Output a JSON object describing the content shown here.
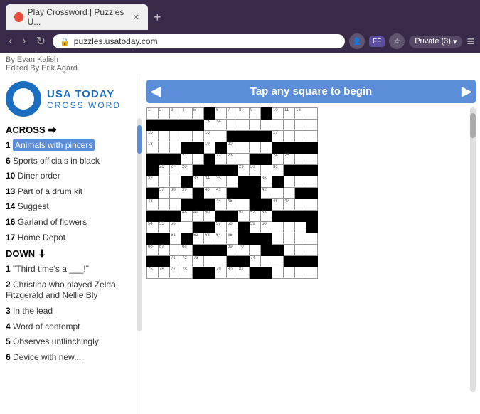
{
  "browser": {
    "tab_title": "Play Crossword | Puzzles U...",
    "url": "puzzles.usatoday.com",
    "private_label": "Private (3)",
    "new_tab_icon": "+",
    "menu_icon": "≡"
  },
  "page": {
    "author": "By Evan Kalish",
    "editor": "Edited By Erik Agard"
  },
  "logo": {
    "usa": "USA TODAY",
    "crossword": "CROSS WORD"
  },
  "clues": {
    "across_label": "ACROSS",
    "down_label": "DOWN",
    "across_items": [
      {
        "number": "1",
        "text": "Animals with pincers"
      },
      {
        "number": "6",
        "text": "Sports officials in black"
      },
      {
        "number": "10",
        "text": "Diner order"
      },
      {
        "number": "13",
        "text": "Part of a drum kit"
      },
      {
        "number": "14",
        "text": "Suggest"
      },
      {
        "number": "16",
        "text": "Garland of flowers"
      },
      {
        "number": "17",
        "text": "Home Depot"
      }
    ],
    "down_items": [
      {
        "number": "1",
        "text": "\"Third time's a ___!\""
      },
      {
        "number": "2",
        "text": "Christina who played Zelda Fitzgerald and Nellie Bly"
      },
      {
        "number": "3",
        "text": "In the lead"
      },
      {
        "number": "4",
        "text": "Word of contempt"
      },
      {
        "number": "5",
        "text": "Observes unflinchingly"
      },
      {
        "number": "6",
        "text": "Device with new..."
      }
    ]
  },
  "grid_header": {
    "title": "Tap any square to begin",
    "left_arrow": "◀",
    "right_arrow": "▶"
  },
  "colors": {
    "blue": "#5b8dd9",
    "dark_blue": "#1a6dbf",
    "black": "#000000",
    "active_clue_bg": "#5b8dd9"
  }
}
